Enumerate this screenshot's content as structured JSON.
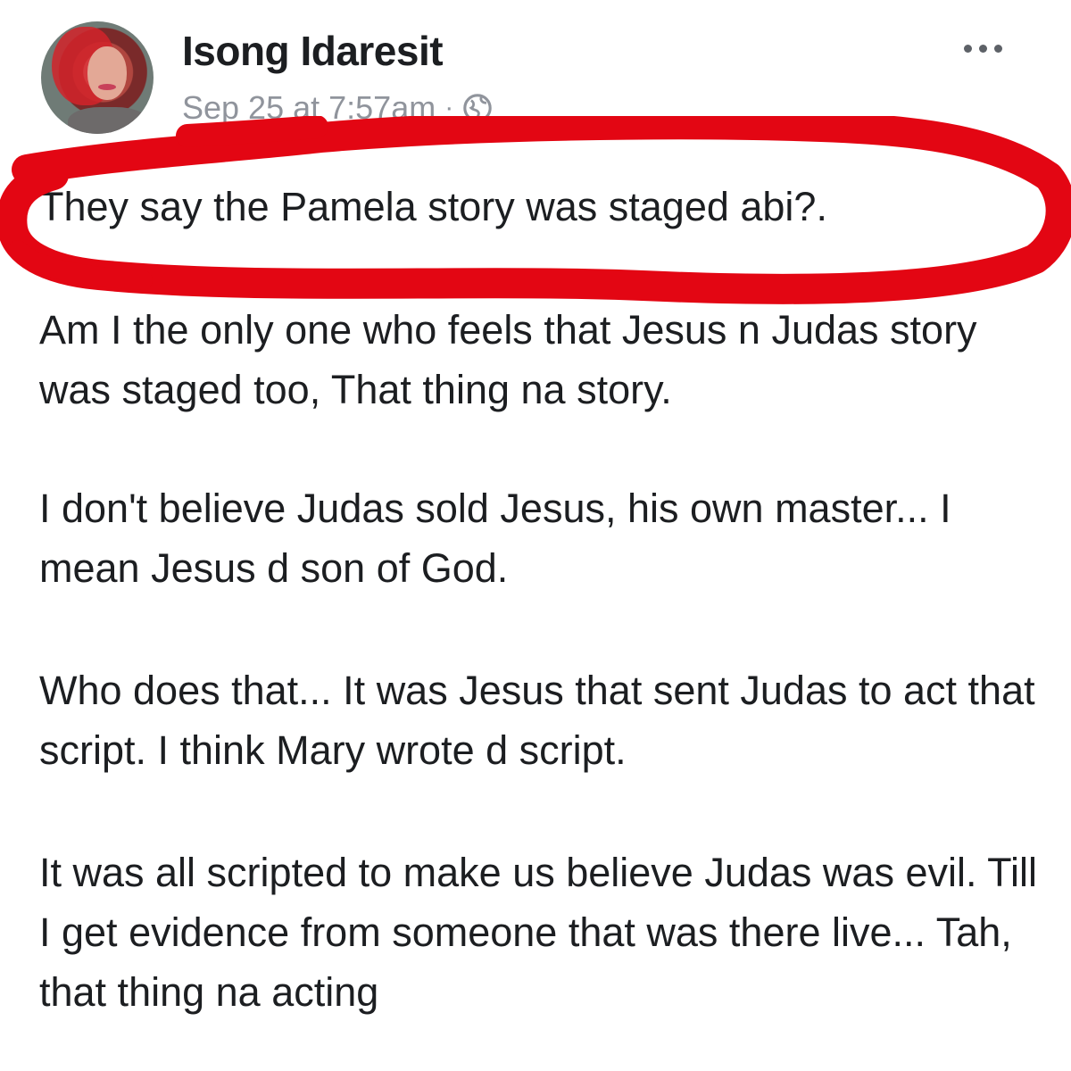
{
  "post": {
    "author": "Isong Idaresit",
    "timestamp": "Sep 25 at 7:57am",
    "separator": "·",
    "privacy_icon": "globe-icon",
    "more_icon": "ellipsis-icon",
    "paragraphs": [
      "They say the Pamela story was staged abi?.",
      "Am I the only one who feels that Jesus n Judas story was staged too, That thing na story.",
      "I don't believe Judas sold Jesus, his own master... I mean Jesus d son of God.",
      "Who does that... It was Jesus that sent Judas to act that script. I think Mary wrote d script.",
      "It was all scripted to make us believe Judas was evil. Till I get evidence from someone that was there live... Tah, that thing na acting"
    ]
  },
  "colors": {
    "annotation": "#e30613",
    "text": "#1c1e21",
    "meta": "#90949c"
  }
}
